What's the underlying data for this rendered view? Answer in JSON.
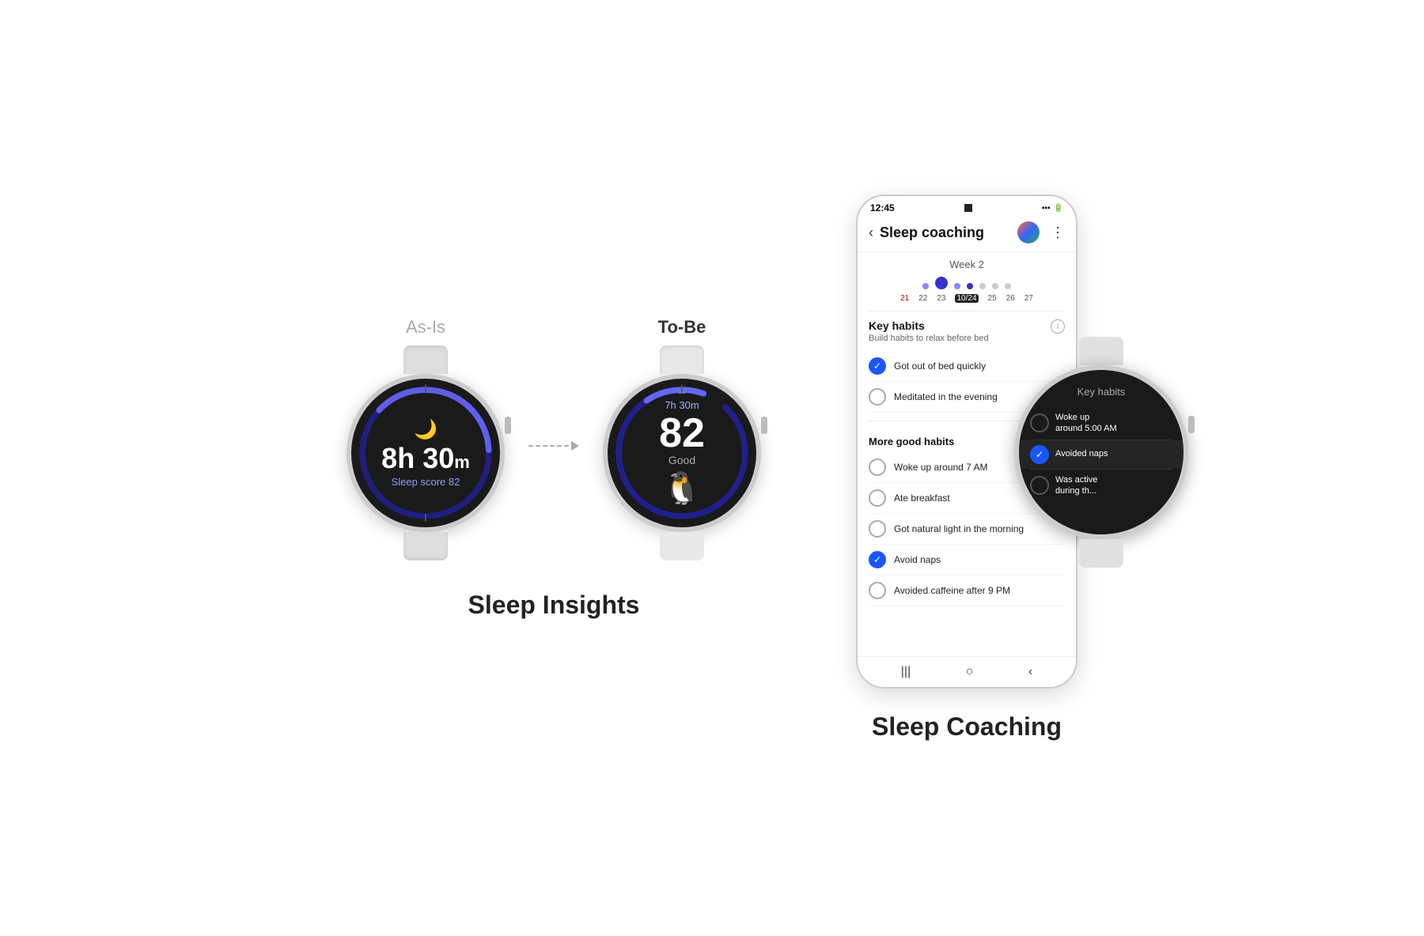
{
  "left_section": {
    "label_asis": "As-Is",
    "label_tobe": "To-Be",
    "watch1": {
      "time": "8h 30m",
      "time_h": "8h",
      "time_m": "30",
      "time_unit": "m",
      "sleep_score_label": "Sleep score",
      "sleep_score": "82"
    },
    "watch2": {
      "duration": "7h 30m",
      "score": "82",
      "score_label": "Good"
    },
    "section_title": "Sleep Insights"
  },
  "right_section": {
    "phone": {
      "status_time": "12:45",
      "header_title": "Sleep coaching",
      "back_icon": "‹",
      "more_icon": "⋮",
      "week_label": "Week 2",
      "calendar": {
        "days": [
          "21",
          "22",
          "23",
          "10/24",
          "25",
          "26",
          "27"
        ]
      },
      "key_habits_title": "Key habits",
      "key_habits_subtitle": "Build habits to relax before bed",
      "key_habits": [
        {
          "text": "Got out of bed quickly",
          "checked": true
        },
        {
          "text": "Meditated in the evening",
          "checked": false
        }
      ],
      "more_good_habits_title": "More good habits",
      "more_habits": [
        {
          "text": "Woke up around 7 AM",
          "checked": false
        },
        {
          "text": "Ate breakfast",
          "checked": false
        },
        {
          "text": "Got natural light in the morning",
          "checked": false
        },
        {
          "text": "Avoid naps",
          "checked": true
        },
        {
          "text": "Avoided caffeine after 9 PM",
          "checked": false
        }
      ]
    },
    "watch_overlay": {
      "title": "Key habits",
      "habits": [
        {
          "text": "Woke up around 5:00 AM",
          "checked": false
        },
        {
          "text": "Avoided naps",
          "checked": true
        },
        {
          "text": "Was active during th...",
          "checked": false
        }
      ]
    },
    "section_title": "Sleep Coaching"
  }
}
